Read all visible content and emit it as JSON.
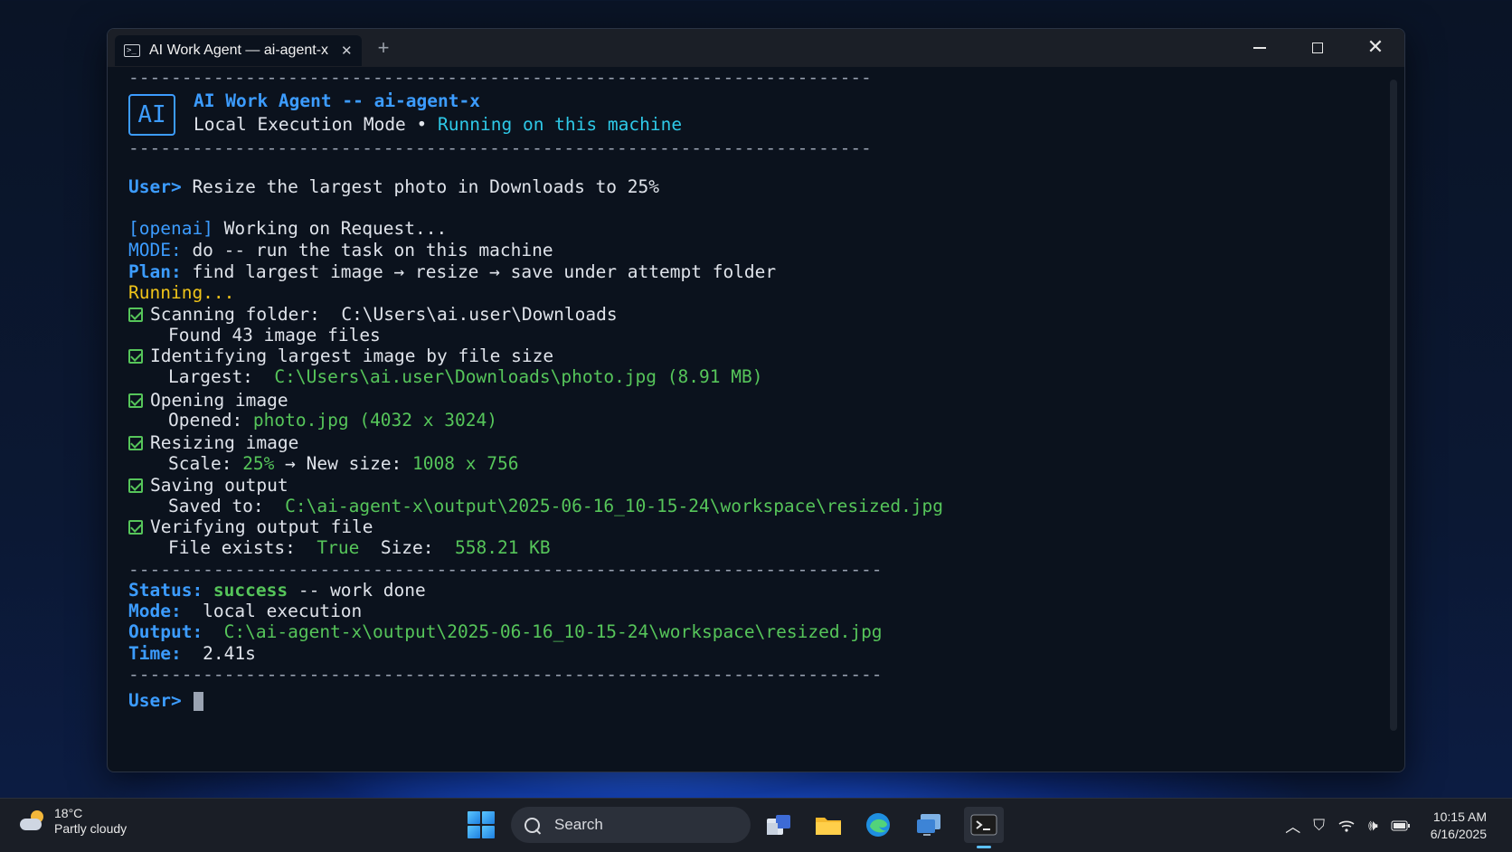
{
  "window": {
    "tab_title": "AI Work Agent — ai-agent-x",
    "tab_close": "✕",
    "new_tab": "+",
    "close": "✕"
  },
  "banner": {
    "logo_text": "AI",
    "rule": "----------------------------------------------------------------------",
    "title": "AI Work Agent -- ai-agent-x",
    "mode": "Local Execution Mode",
    "bullet": " • ",
    "status": "Running on this machine"
  },
  "session": {
    "prompt": "User>",
    "request": " Resize the largest photo in Downloads to 25%",
    "provider": "[openai]",
    "working": " Working on Request...",
    "mode_label": "MODE:",
    "mode_value": " do -- run the task on this machine",
    "plan_label": "Plan:",
    "plan_value": " find largest image → resize → save under attempt folder",
    "running": "Running...",
    "steps": [
      {
        "label": "Scanning folder:",
        "value": "  C:\\Users\\ai.user\\Downloads",
        "detail_label": "Found 43 image files",
        "detail_value": ""
      },
      {
        "label": "Identifying largest image by file size",
        "value": "",
        "detail_label": "Largest:",
        "detail_value": "  C:\\Users\\ai.user\\Downloads\\photo.jpg (8.91 MB)"
      },
      {
        "label": "Opening image",
        "value": "",
        "detail_label": "Opened:",
        "detail_value": " photo.jpg (4032 x 3024)"
      },
      {
        "label": "Resizing image",
        "value": "",
        "detail_label": "Scale:",
        "detail_value": " 25%",
        "detail_mid": " → New size: ",
        "detail_value2": "1008 x 756"
      },
      {
        "label": "Saving output",
        "value": "",
        "detail_label": "Saved to:",
        "detail_value": "  C:\\ai-agent-x\\output\\2025-06-16_10-15-24\\workspace\\resized.jpg"
      },
      {
        "label": "Verifying output file",
        "value": "",
        "detail_label": "File exists:",
        "detail_value": "  True",
        "detail_mid": "  Size: ",
        "detail_value2": " 558.21 KB"
      }
    ],
    "rule2": "-----------------------------------------------------------------------",
    "summary": {
      "status_label": "Status:",
      "status_value": " success",
      "status_note": " -- work done",
      "mode_label": "Mode:",
      "mode_value": "  local execution",
      "output_label": "Output:",
      "output_value": "  C:\\ai-agent-x\\output\\2025-06-16_10-15-24\\workspace\\resized.jpg",
      "time_label": "Time:",
      "time_value": "  2.41s"
    },
    "final_prompt": "User>"
  },
  "taskbar": {
    "weather_temp": "18°C",
    "weather_desc": "Partly cloudy",
    "search_label": "Search",
    "time": "10:15 AM",
    "date": "6/16/2025",
    "icons": [
      "chevron-up-icon",
      "vpn-icon",
      "wifi-icon",
      "volume-icon",
      "battery-icon"
    ]
  },
  "colors": {
    "accent_blue": "#3c9cff",
    "cyan": "#2ec9e8",
    "green": "#56c55a",
    "yellow": "#f0c419"
  }
}
